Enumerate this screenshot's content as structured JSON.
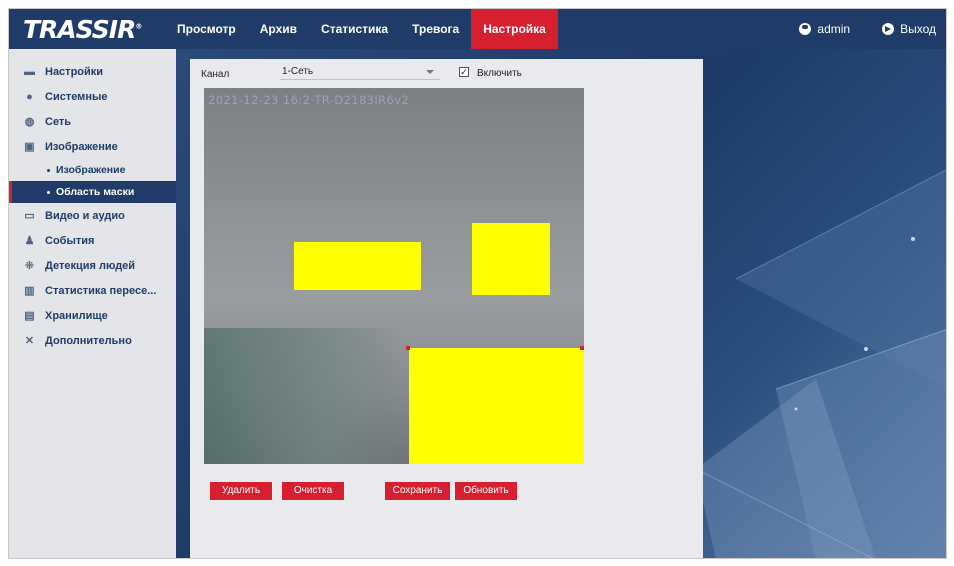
{
  "header": {
    "logo": "TRASSIR",
    "logo_mark": "®",
    "nav": [
      {
        "label": "Просмотр",
        "active": false
      },
      {
        "label": "Архив",
        "active": false
      },
      {
        "label": "Статистика",
        "active": false
      },
      {
        "label": "Тревога",
        "active": false
      },
      {
        "label": "Настройка",
        "active": true
      }
    ],
    "user": "admin",
    "logout": "Выход"
  },
  "sidebar": {
    "items": [
      {
        "label": "Настройки",
        "icon": "monitor-icon"
      },
      {
        "label": "Системные",
        "icon": "info-icon"
      },
      {
        "label": "Сеть",
        "icon": "globe-icon"
      },
      {
        "label": "Изображение",
        "icon": "image-icon"
      }
    ],
    "subitems": [
      {
        "label": "Изображение",
        "active": false
      },
      {
        "label": "Область маски",
        "active": true
      }
    ],
    "items_after": [
      {
        "label": "Видео и аудио",
        "icon": "video-icon"
      },
      {
        "label": "События",
        "icon": "bell-icon"
      },
      {
        "label": "Детекция людей",
        "icon": "person-detect-icon"
      },
      {
        "label": "Статистика пересе...",
        "icon": "chart-icon"
      },
      {
        "label": "Хранилище",
        "icon": "save-icon"
      },
      {
        "label": "Дополнительно",
        "icon": "tools-icon"
      }
    ]
  },
  "form": {
    "channel_label": "Канал",
    "channel_value": "1-Сеть",
    "enable_label": "Включить",
    "enable_checked": true,
    "timestamp": "2021-12-23 16:2·TR-D2183IR6v2"
  },
  "buttons": {
    "delete": "Удалить",
    "clear": "Очистка",
    "save": "Сохранить",
    "refresh": "Обновить"
  },
  "colors": {
    "accent": "#d7202f",
    "header_bg": "#1f3c68",
    "mask": "#ffff00"
  }
}
